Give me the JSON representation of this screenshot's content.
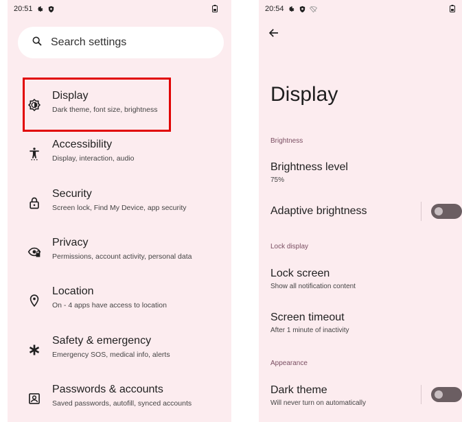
{
  "left": {
    "status": {
      "time": "20:51"
    },
    "search": {
      "placeholder": "Search settings"
    },
    "items": [
      {
        "title": "Display",
        "subtitle": "Dark theme, font size, brightness",
        "icon": "brightness-icon"
      },
      {
        "title": "Accessibility",
        "subtitle": "Display, interaction, audio",
        "icon": "accessibility-icon"
      },
      {
        "title": "Security",
        "subtitle": "Screen lock, Find My Device, app security",
        "icon": "lock-icon"
      },
      {
        "title": "Privacy",
        "subtitle": "Permissions, account activity, personal data",
        "icon": "privacy-eye-icon"
      },
      {
        "title": "Location",
        "subtitle": "On - 4 apps have access to location",
        "icon": "location-pin-icon"
      },
      {
        "title": "Safety & emergency",
        "subtitle": "Emergency SOS, medical info, alerts",
        "icon": "asterisk-icon"
      },
      {
        "title": "Passwords & accounts",
        "subtitle": "Saved passwords, autofill, synced accounts",
        "icon": "account-box-icon"
      }
    ],
    "highlight_color": "#e10000"
  },
  "right": {
    "status": {
      "time": "20:54"
    },
    "title": "Display",
    "sections": {
      "brightness": "Brightness",
      "lock_display": "Lock display",
      "appearance": "Appearance"
    },
    "brightness_level": {
      "title": "Brightness level",
      "value": "75%"
    },
    "adaptive_brightness": {
      "title": "Adaptive brightness",
      "enabled": false
    },
    "lock_screen": {
      "title": "Lock screen",
      "subtitle": "Show all notification content"
    },
    "screen_timeout": {
      "title": "Screen timeout",
      "subtitle": "After 1 minute of inactivity"
    },
    "dark_theme": {
      "title": "Dark theme",
      "subtitle": "Will never turn on automatically",
      "enabled": false
    }
  },
  "colors": {
    "background": "#fcecef",
    "section_header": "#7a4e62",
    "toggle_off_track": "#6b5e62"
  }
}
